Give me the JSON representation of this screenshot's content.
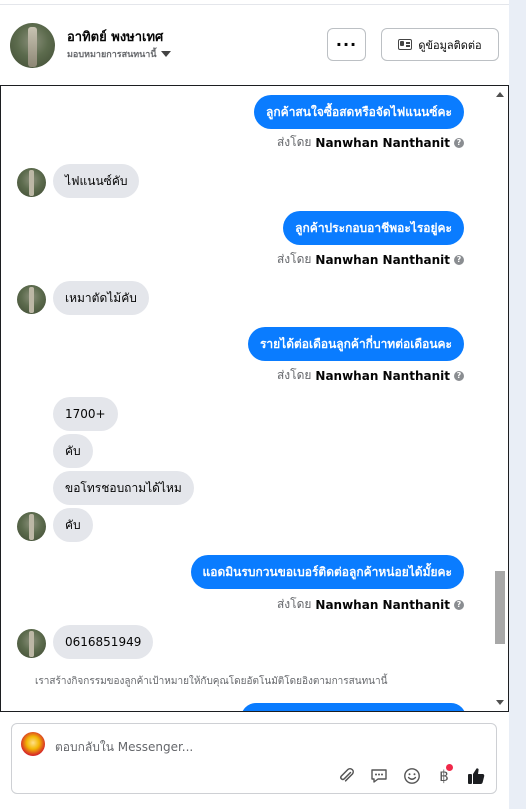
{
  "header": {
    "name": "อาทิตย์ พงษาเทศ",
    "assign_label": "มอบหมายการสนทนานี้",
    "more_label": "···",
    "contact_button_label": "ดูข้อมูลติดต่อ"
  },
  "messages": [
    {
      "direction": "out",
      "text": "ลูกค้าสนใจซื้อสดหรือจัดไฟแนนซ์คะ"
    },
    {
      "direction": "in",
      "text": "ไฟแนนซ์คับ"
    },
    {
      "direction": "out",
      "text": "ลูกค้าประกอบอาชีพอะไรอยู่คะ"
    },
    {
      "direction": "in",
      "text": "เหมาตัดไม้คับ"
    },
    {
      "direction": "out",
      "text": "รายได้ต่อเดือนลูกค้ากี่บาทต่อเดือนคะ"
    },
    {
      "direction": "in",
      "text": "1700+"
    },
    {
      "direction": "in",
      "text": "คับ"
    },
    {
      "direction": "in",
      "text": "ขอโทรชอบถามได้ไหม"
    },
    {
      "direction": "in",
      "text": "คับ"
    },
    {
      "direction": "out",
      "text": "แอดมินรบกวนขอเบอร์ติดต่อลูกค้าหน่อยได้มั้ยคะ"
    },
    {
      "direction": "in",
      "text": "0616851949"
    }
  ],
  "sent_by": {
    "prefix": "ส่งโดย",
    "sender": "Nanwhan Nanthanit",
    "info_glyph": "?"
  },
  "notice": "เราสร้างกิจกรรมของลูกค้าเป้าหมายให้กับคุณโดยอัตโนมัติโดยอิงตามการสนทนานี้",
  "composer": {
    "placeholder": "ตอบกลับใน Messenger..."
  },
  "icons": [
    "contact-card-icon",
    "chevron-down-icon",
    "info-icon",
    "attachment-icon",
    "saved-replies-icon",
    "emoji-icon",
    "baht-icon",
    "thumbs-up-icon"
  ],
  "colors": {
    "outgoing_bubble": "#0a7cff",
    "incoming_bubble": "#e4e6eb",
    "notification_dot": "#f02849"
  }
}
